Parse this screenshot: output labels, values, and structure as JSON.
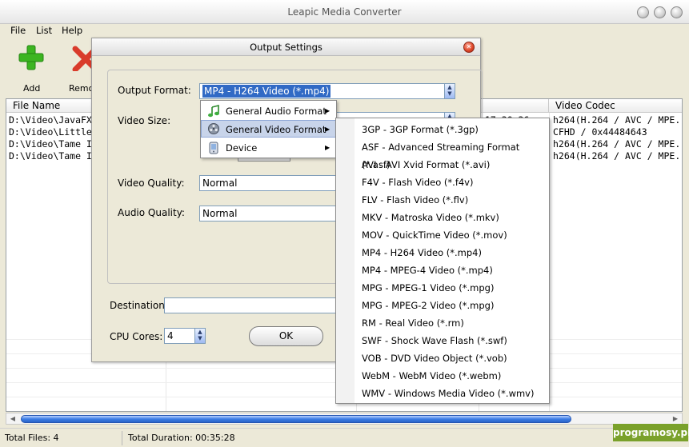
{
  "window": {
    "title": "Leapic Media Converter"
  },
  "menubar": {
    "items": [
      "File",
      "List",
      "Help"
    ]
  },
  "toolbar": {
    "add_label": "Add",
    "remove_label": "Remo"
  },
  "table": {
    "headers": [
      "File Name",
      "Video Codec"
    ],
    "rows": [
      {
        "name": "D:\\Video\\JavaFX t",
        "time": "17:30:36",
        "codec": "h264(H.264 / AVC / MPE..."
      },
      {
        "name": "D:\\Video\\Little Wi",
        "time": "",
        "codec": "CFHD / 0x44484643"
      },
      {
        "name": "D:\\Video\\Tame Im",
        "time": "",
        "codec": "h264(H.264 / AVC / MPE..."
      },
      {
        "name": "D:\\Video\\Tame Im",
        "time": "",
        "codec": "h264(H.264 / AVC / MPE..."
      }
    ]
  },
  "status": {
    "total_files": "Total Files: 4",
    "total_duration": "Total Duration: 00:35:28"
  },
  "watermark": "programosy.pl",
  "dialog": {
    "title": "Output Settings",
    "output_format_label": "Output Format:",
    "output_format_value": "MP4 - H264 Video (*.mp4)",
    "video_size_label": "Video Size:",
    "video_quality_label": "Video Quality:",
    "video_quality_value": "Normal",
    "audio_quality_label": "Audio Quality:",
    "audio_quality_value": "Normal",
    "destination_label": "Destination:",
    "destination_value": "",
    "cpu_cores_label": "CPU Cores:",
    "cpu_cores_value": "4",
    "ok_label": "OK"
  },
  "format_menu": {
    "items": [
      {
        "label": "General Audio Format",
        "icon": "music-note-icon"
      },
      {
        "label": "General Video Format",
        "icon": "film-reel-icon",
        "highlighted": true
      },
      {
        "label": "Device",
        "icon": "phone-device-icon"
      }
    ]
  },
  "video_formats": [
    "3GP - 3GP Format (*.3gp)",
    "ASF - Advanced Streaming Format (*.asf)",
    "AVI - AVI Xvid Format (*.avi)",
    "F4V - Flash Video (*.f4v)",
    "FLV - Flash Video (*.flv)",
    "MKV - Matroska Video (*.mkv)",
    "MOV - QuickTime Video (*.mov)",
    "MP4 - H264 Video (*.mp4)",
    "MP4 - MPEG-4 Video (*.mp4)",
    "MPG - MPEG-1 Video (*.mpg)",
    "MPG - MPEG-2 Video (*.mpg)",
    "RM - Real Video (*.rm)",
    "SWF - Shock Wave Flash (*.swf)",
    "VOB - DVD Video Object (*.vob)",
    "WebM - WebM Video (*.webm)",
    "WMV - Windows Media Video (*.wmv)"
  ],
  "colors": {
    "selection": "#316ac5",
    "scroll_thumb": "#3c7de6",
    "add_icon": "#3cb521",
    "remove_icon": "#d93b2b",
    "watermark_bg": "#7aa12b"
  }
}
